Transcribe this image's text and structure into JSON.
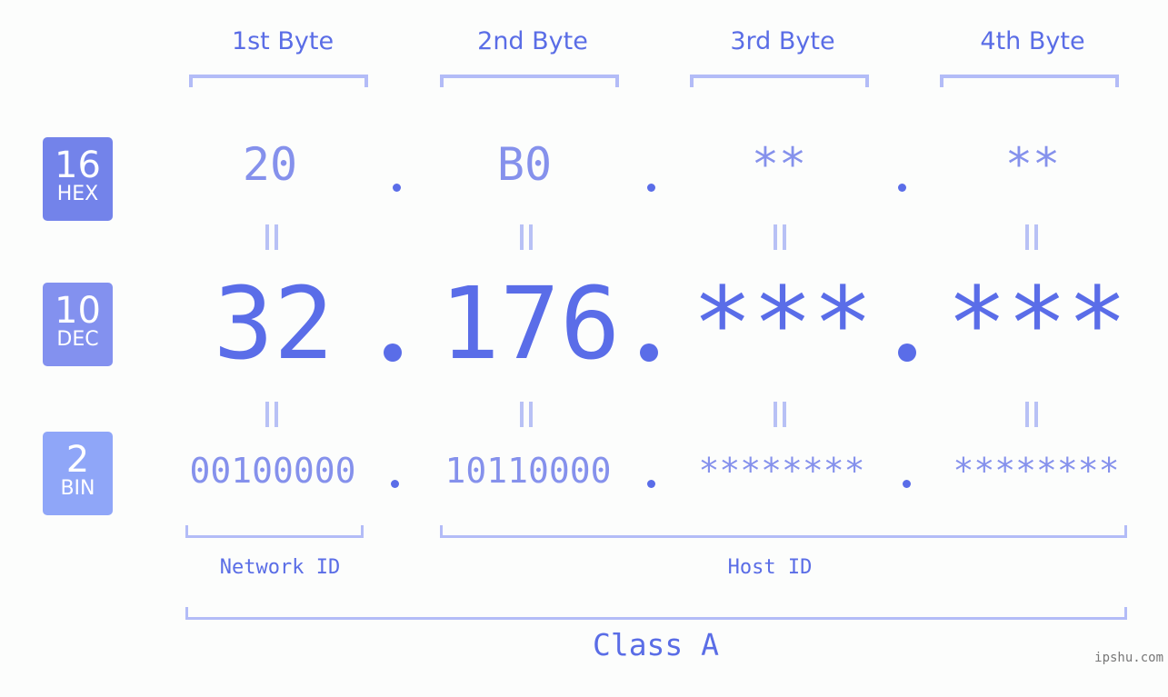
{
  "columns": [
    {
      "header": "1st Byte",
      "hex": "20",
      "dec": "32",
      "bin": "00100000"
    },
    {
      "header": "2nd Byte",
      "hex": "B0",
      "dec": "176",
      "bin": "10110000"
    },
    {
      "header": "3rd Byte",
      "hex": "**",
      "dec": "***",
      "bin": "********"
    },
    {
      "header": "4th Byte",
      "hex": "**",
      "dec": "***",
      "bin": "********"
    }
  ],
  "bases": [
    {
      "number": "16",
      "label": "HEX",
      "color": "#7383ea"
    },
    {
      "number": "10",
      "label": "DEC",
      "color": "#8391ef"
    },
    {
      "number": "2",
      "label": "BIN",
      "color": "#8fa6f8"
    }
  ],
  "segments": {
    "network": "Network ID",
    "host": "Host ID"
  },
  "class_label": "Class A",
  "watermark": "ipshu.com",
  "colors": {
    "accent": "#5a6de8",
    "light_value": "#8591ec",
    "bracket": "#b3bcf7"
  }
}
